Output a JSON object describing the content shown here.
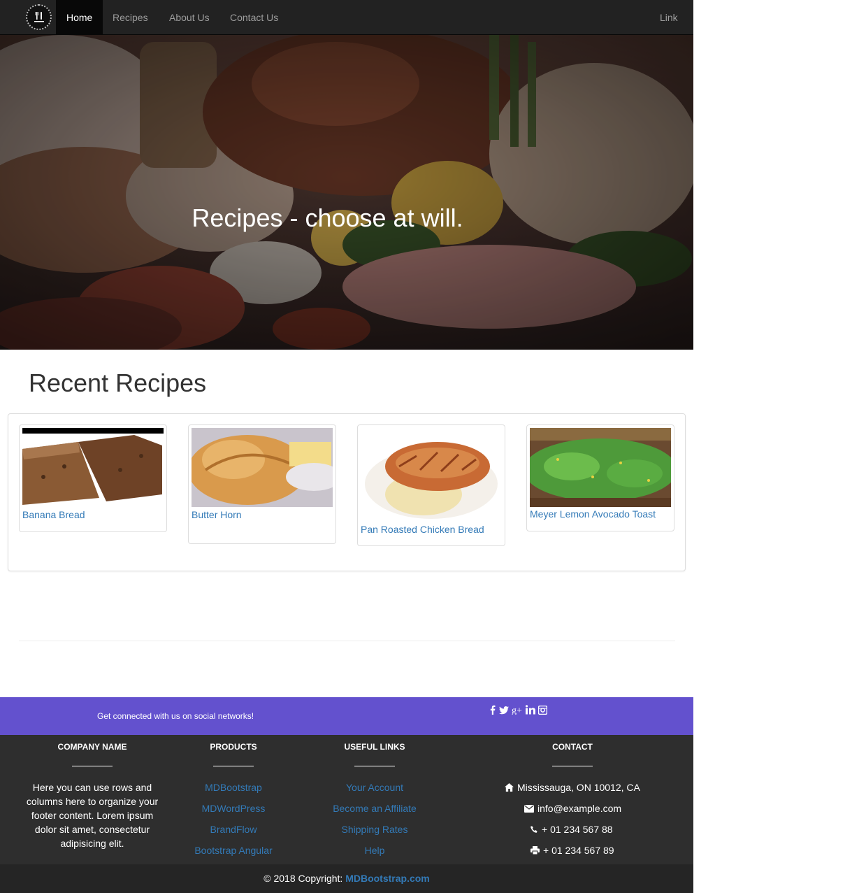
{
  "navbar": {
    "brand_icon": "fork-knife-logo-icon",
    "items": [
      {
        "label": "Home",
        "active": true
      },
      {
        "label": "Recipes",
        "active": false
      },
      {
        "label": "About Us",
        "active": false
      },
      {
        "label": "Contact Us",
        "active": false
      }
    ],
    "right_link": "Link"
  },
  "hero": {
    "title": "Recipes - choose at will."
  },
  "recent": {
    "heading": "Recent Recipes",
    "cards": [
      {
        "title": "Banana Bread",
        "image": "banana-bread-image"
      },
      {
        "title": "Butter Horn",
        "image": "butter-horn-image"
      },
      {
        "title": "Pan Roasted Chicken Bread",
        "image": "roasted-chicken-image"
      },
      {
        "title": "Meyer Lemon Avocado Toast",
        "image": "avocado-toast-image"
      }
    ]
  },
  "social": {
    "text": "Get connected with us on social networks!",
    "icons": [
      "facebook-icon",
      "twitter-icon",
      "google-plus-icon",
      "linkedin-icon",
      "instagram-icon"
    ]
  },
  "footer": {
    "company": {
      "heading": "COMPANY NAME",
      "text": "Here you can use rows and columns here to organize your footer content. Lorem ipsum dolor sit amet, consectetur adipisicing elit."
    },
    "products": {
      "heading": "PRODUCTS",
      "links": [
        "MDBootstrap",
        "MDWordPress",
        "BrandFlow",
        "Bootstrap Angular"
      ]
    },
    "useful": {
      "heading": "USEFUL LINKS",
      "links": [
        "Your Account",
        "Become an Affiliate",
        "Shipping Rates",
        "Help"
      ]
    },
    "contact": {
      "heading": "CONTACT",
      "address": "Mississauga, ON 10012, CA",
      "email": "info@example.com",
      "phone": "+ 01 234 567 88",
      "fax": "+ 01 234 567 89"
    },
    "copyright_prefix": "© 2018 Copyright:",
    "copyright_link": "MDBootstrap.com"
  },
  "colors": {
    "navbar": "#222222",
    "social_bar": "#6351ce",
    "footer": "#2e2e2e",
    "link": "#337ab7"
  }
}
